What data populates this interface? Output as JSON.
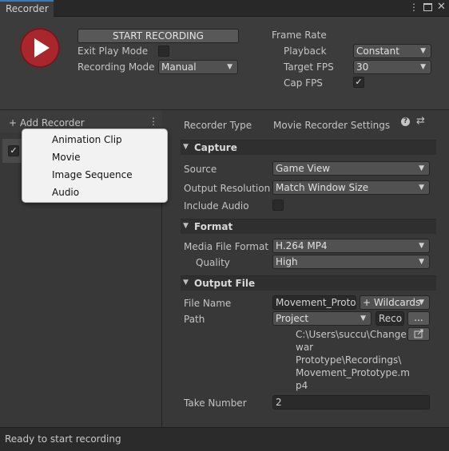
{
  "window": {
    "tab_title": "Recorder",
    "menu_icon": "kebab-menu-icon",
    "maximize_icon": "maximize-icon",
    "close_icon": "close-icon"
  },
  "header": {
    "record_icon": "play-record-icon",
    "start_button": "START RECORDING",
    "exit_play_mode_label": "Exit Play Mode",
    "recording_mode_label": "Recording Mode",
    "recording_mode_value": "Manual",
    "frame_rate_title": "Frame Rate",
    "playback_label": "Playback",
    "playback_value": "Constant",
    "target_fps_label": "Target FPS",
    "target_fps_value": "30",
    "cap_fps_label": "Cap FPS",
    "cap_fps_checked": true
  },
  "recorder_list": {
    "add_label": "+ Add Recorder",
    "menu_icon": "kebab-menu-icon"
  },
  "add_menu": {
    "items": [
      "Animation Clip",
      "Movie",
      "Image Sequence",
      "Audio"
    ]
  },
  "settings": {
    "recorder_type_label": "Recorder Type",
    "recorder_type_value": "Movie Recorder Settings",
    "help_icon": "help-icon",
    "preset_icon": "preset-settings-icon",
    "capture": {
      "title": "Capture",
      "source_label": "Source",
      "source_value": "Game View",
      "output_resolution_label": "Output Resolution",
      "output_resolution_value": "Match Window Size",
      "include_audio_label": "Include Audio"
    },
    "format": {
      "title": "Format",
      "media_file_format_label": "Media File Format",
      "media_file_format_value": "H.264 MP4",
      "quality_label": "Quality",
      "quality_value": "High"
    },
    "output_file": {
      "title": "Output File",
      "file_name_label": "File Name",
      "file_name_value": "Movement_Protot",
      "wildcards_label": "+ Wildcards",
      "path_label": "Path",
      "path_root_value": "Project",
      "path_sub_value": "Reco",
      "browse_label": "...",
      "open_folder_icon": "open-folder-icon",
      "full_path_lines": [
        "C:\\Users\\succu\\Change",
        "war",
        "Prototype\\Recordings\\",
        "Movement_Prototype.m",
        "p4"
      ],
      "take_number_label": "Take Number",
      "take_number_value": "2"
    }
  },
  "status": {
    "text": "Ready to start recording"
  }
}
